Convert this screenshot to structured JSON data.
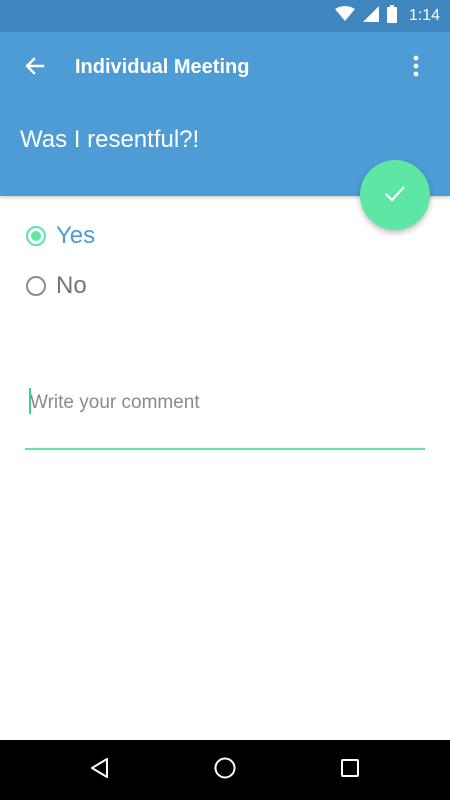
{
  "status_bar": {
    "time": "1:14",
    "icons": [
      "wifi-icon",
      "signal-icon",
      "battery-icon"
    ]
  },
  "toolbar": {
    "back_icon": "arrow-left-icon",
    "title": "Individual Meeting",
    "overflow_icon": "more-vert-icon"
  },
  "question": {
    "title": "Was I resentful?!"
  },
  "fab": {
    "icon": "check-icon"
  },
  "answers": {
    "options": [
      {
        "label": "Yes",
        "selected": true
      },
      {
        "label": "No",
        "selected": false
      }
    ]
  },
  "comment": {
    "value": "",
    "placeholder": "Write your comment"
  },
  "nav_bar": {
    "icons": [
      "back-triangle-icon",
      "home-circle-icon",
      "recents-square-icon"
    ]
  },
  "colors": {
    "status_bar": "#3f86bf",
    "app_bar": "#4d9cd5",
    "accent": "#5ee6a5"
  }
}
